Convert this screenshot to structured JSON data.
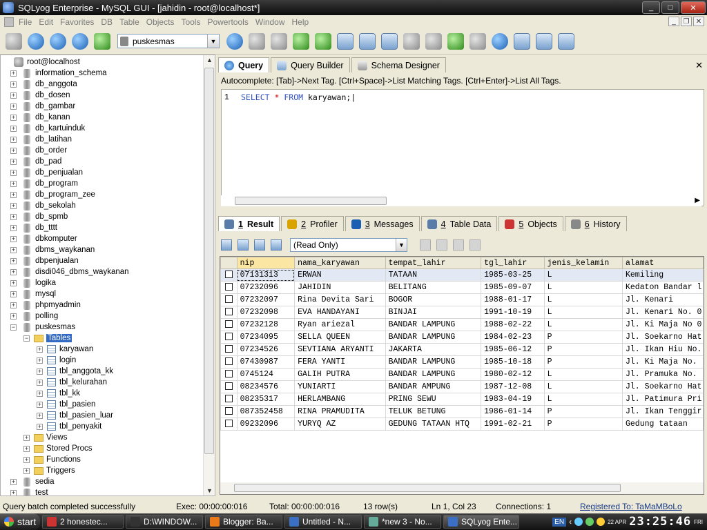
{
  "window": {
    "title": "SQLyog Enterprise - MySQL GUI - [jahidin - root@localhost*]"
  },
  "menu": [
    "File",
    "Edit",
    "Favorites",
    "DB",
    "Table",
    "Objects",
    "Tools",
    "Powertools",
    "Window",
    "Help"
  ],
  "toolbar": {
    "db_selected": "puskesmas"
  },
  "object_browser": {
    "root": "root@localhost",
    "databases": [
      "information_schema",
      "db_anggota",
      "db_dosen",
      "db_gambar",
      "db_kanan",
      "db_kartuinduk",
      "db_latihan",
      "db_order",
      "db_pad",
      "db_penjualan",
      "db_program",
      "db_program_zee",
      "db_sekolah",
      "db_spmb",
      "db_tttt",
      "dbkomputer",
      "dbms_waykanan",
      "dbpenjualan",
      "disdi046_dbms_waykanan",
      "logika",
      "mysql",
      "phpmyadmin",
      "polling",
      "puskesmas"
    ],
    "tables_folder": "Tables",
    "tables": [
      "karyawan",
      "login",
      "tbl_anggota_kk",
      "tbl_kelurahan",
      "tbl_kk",
      "tbl_pasien",
      "tbl_pasien_luar",
      "tbl_penyakit"
    ],
    "other_folders": [
      "Views",
      "Stored Procs",
      "Functions",
      "Triggers"
    ],
    "more_databases": [
      "sedia",
      "test"
    ]
  },
  "query_tabs": [
    "Query",
    "Query Builder",
    "Schema Designer"
  ],
  "autocomplete": "Autocomplete: [Tab]->Next Tag. [Ctrl+Space]->List Matching Tags. [Ctrl+Enter]->List All Tags.",
  "editor": {
    "line_no": "1",
    "kw1": "SELECT",
    "star": "*",
    "kw2": "FROM",
    "table": "karyawan;"
  },
  "result_tabs": [
    {
      "num": "1",
      "label": "Result"
    },
    {
      "num": "2",
      "label": "Profiler"
    },
    {
      "num": "3",
      "label": "Messages"
    },
    {
      "num": "4",
      "label": "Table Data"
    },
    {
      "num": "5",
      "label": "Objects"
    },
    {
      "num": "6",
      "label": "History"
    }
  ],
  "read_only": "(Read Only)",
  "grid": {
    "columns": [
      "nip",
      "nama_karyawan",
      "tempat_lahir",
      "tgl_lahir",
      "jenis_kelamin",
      "alamat"
    ],
    "rows": [
      [
        "07131313",
        "ERWAN",
        "TATAAN",
        "1985-03-25",
        "L",
        "Kemiling"
      ],
      [
        "07232096",
        "JAHIDIN",
        "BELITANG",
        "1985-09-07",
        "L",
        "Kedaton Bandar l"
      ],
      [
        "07232097",
        "Rina Devita Sari",
        "BOGOR",
        "1988-01-17",
        "L",
        "Jl. Kenari"
      ],
      [
        "07232098",
        "EVA HANDAYANI",
        "BINJAI",
        "1991-10-19",
        "L",
        "Jl. Kenari No. 0"
      ],
      [
        "07232128",
        "Ryan ariezal",
        "BANDAR LAMPUNG",
        "1988-02-22",
        "L",
        "Jl. Ki Maja No 0"
      ],
      [
        "07234095",
        "SELLA QUEEN",
        "BANDAR LAMPUNG",
        "1984-02-23",
        "P",
        "Jl. Soekarno Hat"
      ],
      [
        "07234526",
        "SEVTIANA ARYANTI",
        "JAKARTA",
        "1985-06-12",
        "P",
        "Jl. Ikan Hiu No."
      ],
      [
        "07430987",
        "FERA YANTI",
        "BANDAR LAMPUNG",
        "1985-10-18",
        "P",
        "Jl. Ki Maja No."
      ],
      [
        "0745124",
        "GALIH PUTRA",
        "BANDAR LAMPUNG",
        "1980-02-12",
        "L",
        "Jl. Pramuka No."
      ],
      [
        "08234576",
        "YUNIARTI",
        "BANDAR AMPUNG",
        "1987-12-08",
        "L",
        "Jl. Soekarno Hat"
      ],
      [
        "08235317",
        "HERLAMBANG",
        "PRING SEWU",
        "1983-04-19",
        "L",
        "Jl. Patimura Pri"
      ],
      [
        "087352458",
        "RINA PRAMUDITA",
        "TELUK BETUNG",
        "1986-01-14",
        "P",
        "Jl. Ikan Tenggir"
      ],
      [
        "09232096",
        "YURYQ AZ",
        "GEDUNG TATAAN HTQ",
        "1991-02-21",
        "P",
        "Gedung tataan"
      ]
    ]
  },
  "status": {
    "message": "Query batch completed successfully",
    "exec": "Exec: 00:00:00:016",
    "total": "Total: 00:00:00:016",
    "rows": "13 row(s)",
    "position": "Ln 1, Col 23",
    "connections": "Connections: 1",
    "registered": "Registered To: TaMaMBoLo"
  },
  "taskbar": {
    "start": "start",
    "tasks": [
      "2 honestec...",
      "D:\\WINDOW...",
      "Blogger: Ba...",
      "Untitled - N...",
      "*new 3 - No...",
      "SQLyog Ente..."
    ],
    "lang": "EN",
    "time": "23:25:46",
    "day": "FRI",
    "date": "22 APR"
  }
}
